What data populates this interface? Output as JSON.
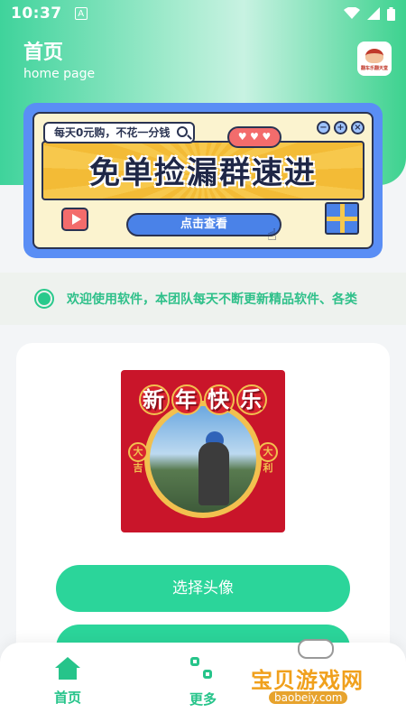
{
  "status_bar": {
    "time": "10:37",
    "notification_glyph": "A",
    "icons": [
      "wifi-icon",
      "signal-icon",
      "battery-icon"
    ]
  },
  "header": {
    "title": "首页",
    "subtitle": "home page",
    "logo_text": "翻车乐翻天堂"
  },
  "banner": {
    "search_text": "每天0元购，不花一分钱",
    "headline": "免单捡漏群速进",
    "cta_label": "点击查看",
    "window_buttons": [
      "−",
      "+",
      "×"
    ]
  },
  "notice": {
    "text": "欢迎使用软件，本团队每天不断更新精品软件、各类"
  },
  "avatar": {
    "title_chars": [
      "新",
      "年",
      "快",
      "乐"
    ],
    "left_seal": "大吉",
    "right_seal": "大利"
  },
  "buttons": {
    "choose_avatar": "选择头像"
  },
  "tabbar": {
    "home": "首页",
    "more": "更多"
  },
  "watermark": {
    "text": "宝贝游戏网",
    "url": "baobeiy.com"
  },
  "colors": {
    "accent": "#2bd59a",
    "banner_blue": "#5a8ef5",
    "notice_green": "#29c98c"
  }
}
